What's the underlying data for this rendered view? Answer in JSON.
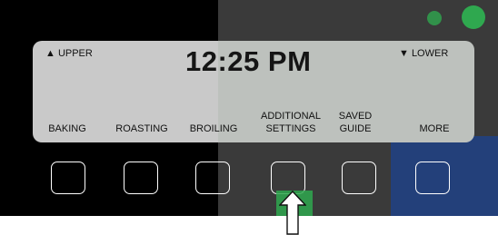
{
  "display": {
    "upper_label": "▲ UPPER",
    "lower_label": "▼ LOWER",
    "time": "12:25 PM"
  },
  "soft_keys": [
    {
      "line1": "",
      "line2": "BAKING"
    },
    {
      "line1": "",
      "line2": "ROASTING"
    },
    {
      "line1": "",
      "line2": "BROILING"
    },
    {
      "line1": "ADDITIONAL",
      "line2": "SETTINGS"
    },
    {
      "line1": "SAVED",
      "line2": "GUIDE"
    },
    {
      "line1": "",
      "line2": "MORE"
    }
  ],
  "colors": {
    "panel": "#000000",
    "lcd": "#c9c9c9",
    "watermark_green": "#2fa84f",
    "watermark_navy": "#23407a"
  },
  "pointer": {
    "icon": "up-arrow-icon",
    "target_key": 4
  }
}
